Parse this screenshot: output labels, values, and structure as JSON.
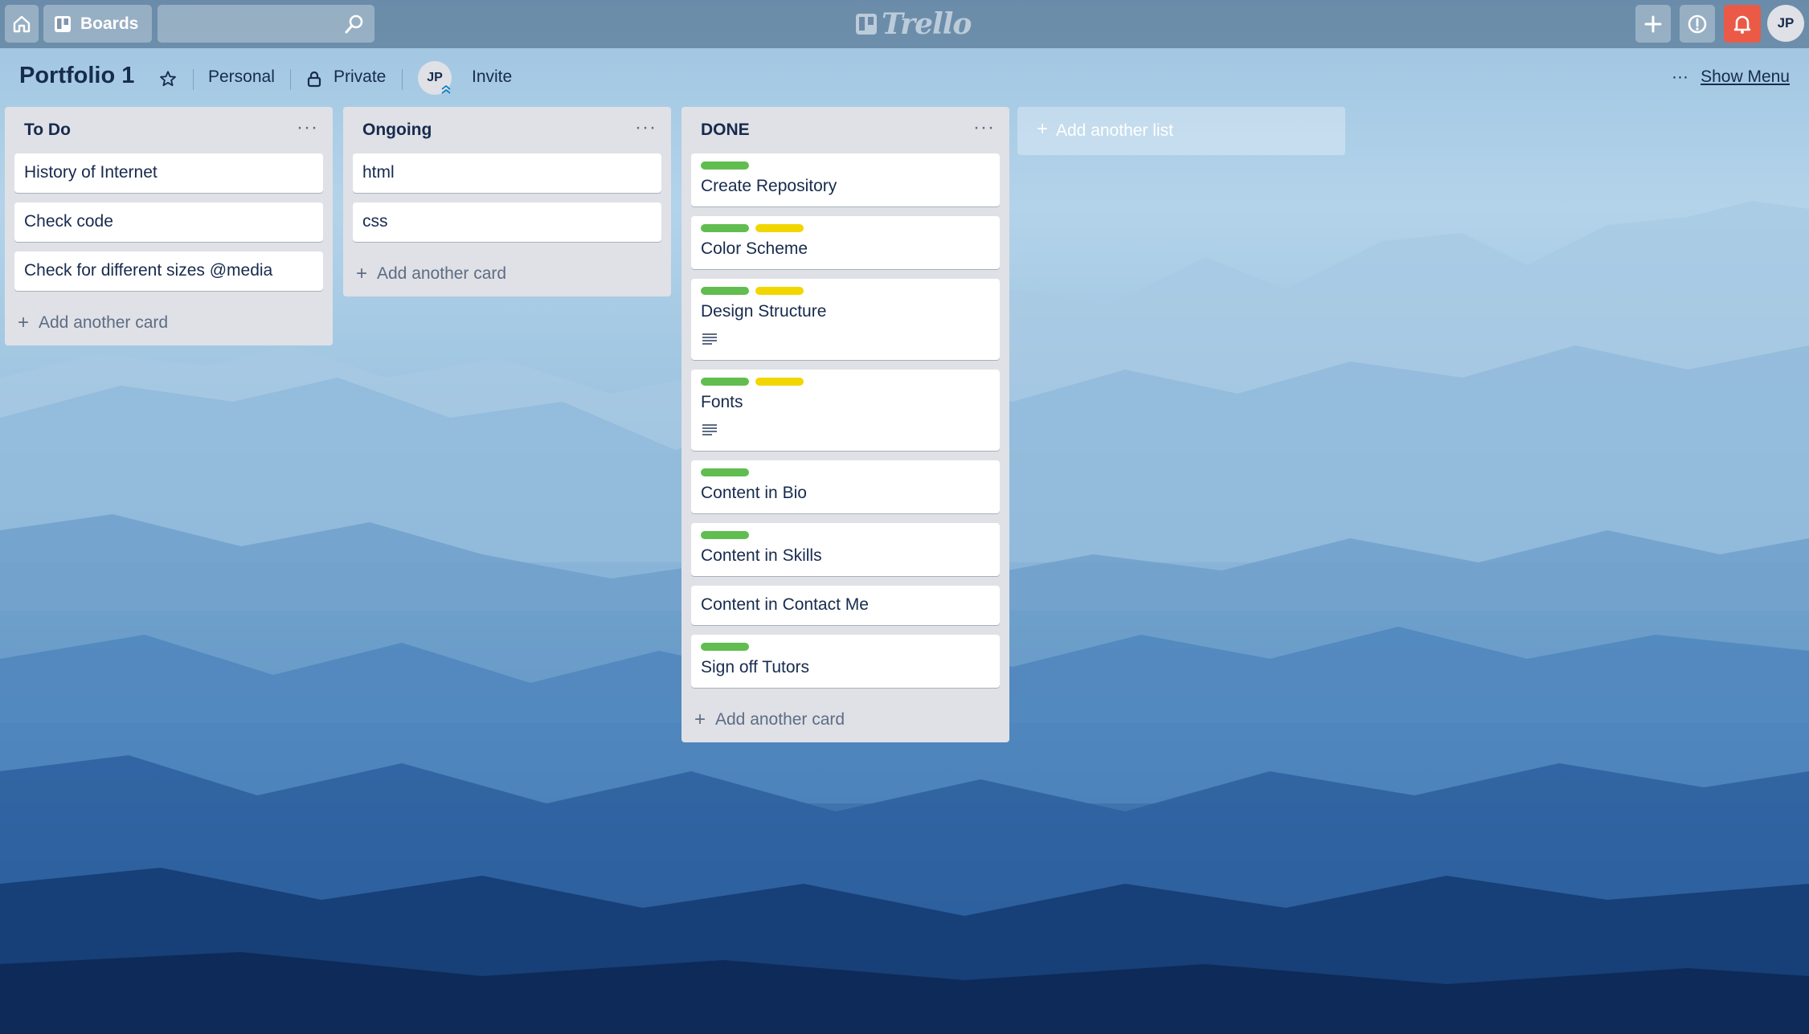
{
  "topbar": {
    "boards_label": "Boards",
    "logo_text": "Trello",
    "avatar_initials": "JP"
  },
  "board": {
    "title": "Portfolio 1",
    "team": "Personal",
    "visibility": "Private",
    "member_initials": "JP",
    "invite_label": "Invite",
    "menu_dots": "···",
    "show_menu_label": "Show Menu"
  },
  "colors": {
    "label_green": "#61bd4f",
    "label_yellow": "#f2d600",
    "notification": "#eb5a46",
    "list_bg": "#dfe1e6"
  },
  "lists": [
    {
      "title": "To Do",
      "menu": "···",
      "cards": [
        {
          "title": "History of Internet"
        },
        {
          "title": "Check code"
        },
        {
          "title": "Check for different sizes @media"
        }
      ],
      "add_card_label": "Add another card"
    },
    {
      "title": "Ongoing",
      "menu": "···",
      "cards": [
        {
          "title": "html"
        },
        {
          "title": "css"
        }
      ],
      "add_card_label": "Add another card"
    },
    {
      "title": "DONE",
      "menu": "···",
      "cards": [
        {
          "title": "Create Repository",
          "labels": [
            "green"
          ],
          "description_icon": false
        },
        {
          "title": "Color Scheme",
          "labels": [
            "green",
            "yellow"
          ],
          "description_icon": false
        },
        {
          "title": "Design Structure",
          "labels": [
            "green",
            "yellow"
          ],
          "description_icon": true
        },
        {
          "title": "Fonts",
          "labels": [
            "green",
            "yellow"
          ],
          "description_icon": true
        },
        {
          "title": "Content in Bio",
          "labels": [
            "green"
          ],
          "description_icon": false
        },
        {
          "title": "Content in Skills",
          "labels": [
            "green"
          ],
          "description_icon": false
        },
        {
          "title": "Content in Contact Me",
          "labels": [],
          "description_icon": false
        },
        {
          "title": "Sign off Tutors",
          "labels": [
            "green"
          ],
          "description_icon": false
        }
      ],
      "add_card_label": "Add another card"
    }
  ],
  "add_list_label": "Add another list"
}
